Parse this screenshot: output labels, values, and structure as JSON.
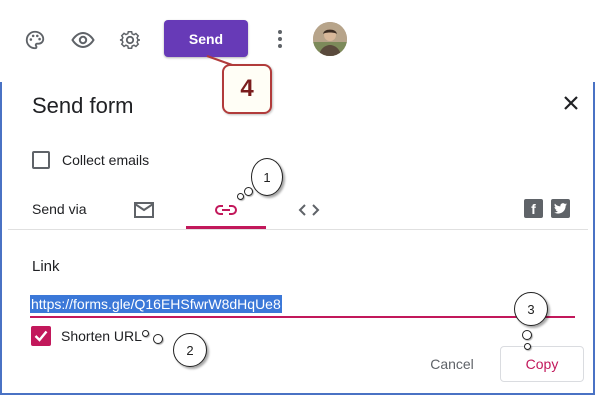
{
  "toolbar": {
    "icons": [
      "palette-icon",
      "eye-icon",
      "gear-icon",
      "more-vert-icon"
    ],
    "send_label": "Send",
    "accent_color": "#673ab7"
  },
  "annotations": {
    "send_step": "4",
    "link_tab_step": "1",
    "shorten_step": "2",
    "copy_step": "3"
  },
  "dialog": {
    "title": "Send form",
    "collect_emails_label": "Collect emails",
    "collect_emails_checked": false,
    "send_via_label": "Send via",
    "tabs": [
      {
        "name": "email",
        "icon": "mail-icon",
        "active": false
      },
      {
        "name": "link",
        "icon": "link-icon",
        "active": true
      },
      {
        "name": "embed",
        "icon": "code-icon",
        "active": false
      }
    ],
    "social": [
      "facebook-icon",
      "twitter-icon"
    ],
    "link_section_title": "Link",
    "link_url": "https://forms.gle/Q16EHSfwrW8dHqUe8",
    "shorten_url_label": "Shorten URL",
    "shorten_url_checked": true,
    "cancel_label": "Cancel",
    "copy_label": "Copy",
    "highlight_color": "#c2185b"
  }
}
